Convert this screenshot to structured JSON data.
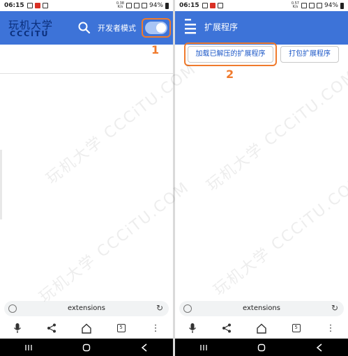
{
  "colors": {
    "appbar": "#3d73d8",
    "highlight": "#f07a2c",
    "link_text": "#1a56c7",
    "toggle_track": "#a9c5f5"
  },
  "left": {
    "status": {
      "time": "06:15",
      "speed_top": "0.38",
      "speed_bottom": "K/s",
      "battery": "94%"
    },
    "logo": {
      "line1": "玩机大学",
      "line2": "CCCiTU"
    },
    "search_icon": "search-icon",
    "developer_mode_label": "开发者模式",
    "developer_mode_on": true,
    "step_label": "1",
    "address_bar": {
      "url": "extensions"
    },
    "toolbar": {
      "tab_count": "5"
    }
  },
  "right": {
    "status": {
      "time": "06:15",
      "speed_top": "0.57",
      "speed_bottom": "K/s",
      "battery": "94%"
    },
    "menu_icon": "hamburger-icon",
    "page_title": "扩展程序",
    "buttons": {
      "load_unpacked": "加载已解压的扩展程序",
      "pack_extension": "打包扩展程序"
    },
    "step_label": "2",
    "address_bar": {
      "url": "extensions"
    },
    "toolbar": {
      "tab_count": "5"
    }
  },
  "watermark_text": "玩机大学 CCCiTU.COM"
}
